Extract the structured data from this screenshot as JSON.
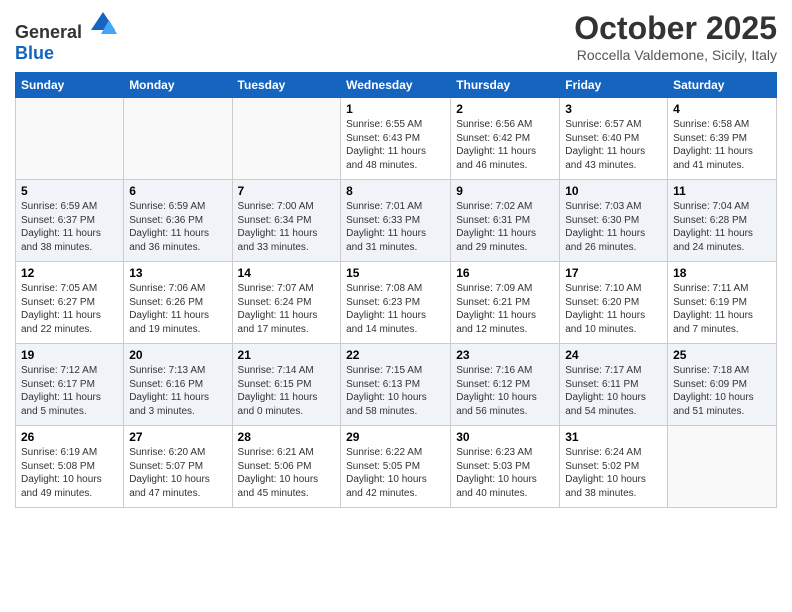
{
  "header": {
    "logo_general": "General",
    "logo_blue": "Blue",
    "month": "October 2025",
    "location": "Roccella Valdemone, Sicily, Italy"
  },
  "days_of_week": [
    "Sunday",
    "Monday",
    "Tuesday",
    "Wednesday",
    "Thursday",
    "Friday",
    "Saturday"
  ],
  "weeks": [
    [
      {
        "day": "",
        "info": ""
      },
      {
        "day": "",
        "info": ""
      },
      {
        "day": "",
        "info": ""
      },
      {
        "day": "1",
        "info": "Sunrise: 6:55 AM\nSunset: 6:43 PM\nDaylight: 11 hours and 48 minutes."
      },
      {
        "day": "2",
        "info": "Sunrise: 6:56 AM\nSunset: 6:42 PM\nDaylight: 11 hours and 46 minutes."
      },
      {
        "day": "3",
        "info": "Sunrise: 6:57 AM\nSunset: 6:40 PM\nDaylight: 11 hours and 43 minutes."
      },
      {
        "day": "4",
        "info": "Sunrise: 6:58 AM\nSunset: 6:39 PM\nDaylight: 11 hours and 41 minutes."
      }
    ],
    [
      {
        "day": "5",
        "info": "Sunrise: 6:59 AM\nSunset: 6:37 PM\nDaylight: 11 hours and 38 minutes."
      },
      {
        "day": "6",
        "info": "Sunrise: 6:59 AM\nSunset: 6:36 PM\nDaylight: 11 hours and 36 minutes."
      },
      {
        "day": "7",
        "info": "Sunrise: 7:00 AM\nSunset: 6:34 PM\nDaylight: 11 hours and 33 minutes."
      },
      {
        "day": "8",
        "info": "Sunrise: 7:01 AM\nSunset: 6:33 PM\nDaylight: 11 hours and 31 minutes."
      },
      {
        "day": "9",
        "info": "Sunrise: 7:02 AM\nSunset: 6:31 PM\nDaylight: 11 hours and 29 minutes."
      },
      {
        "day": "10",
        "info": "Sunrise: 7:03 AM\nSunset: 6:30 PM\nDaylight: 11 hours and 26 minutes."
      },
      {
        "day": "11",
        "info": "Sunrise: 7:04 AM\nSunset: 6:28 PM\nDaylight: 11 hours and 24 minutes."
      }
    ],
    [
      {
        "day": "12",
        "info": "Sunrise: 7:05 AM\nSunset: 6:27 PM\nDaylight: 11 hours and 22 minutes."
      },
      {
        "day": "13",
        "info": "Sunrise: 7:06 AM\nSunset: 6:26 PM\nDaylight: 11 hours and 19 minutes."
      },
      {
        "day": "14",
        "info": "Sunrise: 7:07 AM\nSunset: 6:24 PM\nDaylight: 11 hours and 17 minutes."
      },
      {
        "day": "15",
        "info": "Sunrise: 7:08 AM\nSunset: 6:23 PM\nDaylight: 11 hours and 14 minutes."
      },
      {
        "day": "16",
        "info": "Sunrise: 7:09 AM\nSunset: 6:21 PM\nDaylight: 11 hours and 12 minutes."
      },
      {
        "day": "17",
        "info": "Sunrise: 7:10 AM\nSunset: 6:20 PM\nDaylight: 11 hours and 10 minutes."
      },
      {
        "day": "18",
        "info": "Sunrise: 7:11 AM\nSunset: 6:19 PM\nDaylight: 11 hours and 7 minutes."
      }
    ],
    [
      {
        "day": "19",
        "info": "Sunrise: 7:12 AM\nSunset: 6:17 PM\nDaylight: 11 hours and 5 minutes."
      },
      {
        "day": "20",
        "info": "Sunrise: 7:13 AM\nSunset: 6:16 PM\nDaylight: 11 hours and 3 minutes."
      },
      {
        "day": "21",
        "info": "Sunrise: 7:14 AM\nSunset: 6:15 PM\nDaylight: 11 hours and 0 minutes."
      },
      {
        "day": "22",
        "info": "Sunrise: 7:15 AM\nSunset: 6:13 PM\nDaylight: 10 hours and 58 minutes."
      },
      {
        "day": "23",
        "info": "Sunrise: 7:16 AM\nSunset: 6:12 PM\nDaylight: 10 hours and 56 minutes."
      },
      {
        "day": "24",
        "info": "Sunrise: 7:17 AM\nSunset: 6:11 PM\nDaylight: 10 hours and 54 minutes."
      },
      {
        "day": "25",
        "info": "Sunrise: 7:18 AM\nSunset: 6:09 PM\nDaylight: 10 hours and 51 minutes."
      }
    ],
    [
      {
        "day": "26",
        "info": "Sunrise: 6:19 AM\nSunset: 5:08 PM\nDaylight: 10 hours and 49 minutes."
      },
      {
        "day": "27",
        "info": "Sunrise: 6:20 AM\nSunset: 5:07 PM\nDaylight: 10 hours and 47 minutes."
      },
      {
        "day": "28",
        "info": "Sunrise: 6:21 AM\nSunset: 5:06 PM\nDaylight: 10 hours and 45 minutes."
      },
      {
        "day": "29",
        "info": "Sunrise: 6:22 AM\nSunset: 5:05 PM\nDaylight: 10 hours and 42 minutes."
      },
      {
        "day": "30",
        "info": "Sunrise: 6:23 AM\nSunset: 5:03 PM\nDaylight: 10 hours and 40 minutes."
      },
      {
        "day": "31",
        "info": "Sunrise: 6:24 AM\nSunset: 5:02 PM\nDaylight: 10 hours and 38 minutes."
      },
      {
        "day": "",
        "info": ""
      }
    ]
  ]
}
